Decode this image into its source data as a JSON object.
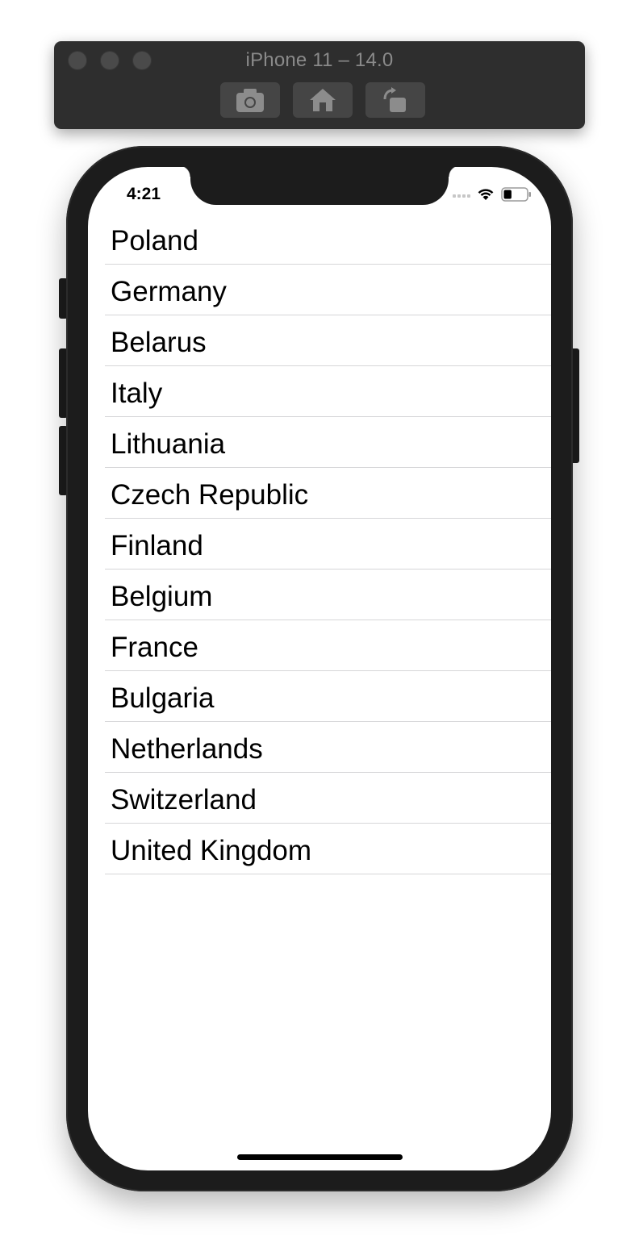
{
  "simulator": {
    "title": "iPhone 11 – 14.0",
    "toolbar_buttons": [
      {
        "icon": "camera-icon",
        "action": "screenshot"
      },
      {
        "icon": "home-icon",
        "action": "home"
      },
      {
        "icon": "rotate-icon",
        "action": "rotate"
      }
    ]
  },
  "status_bar": {
    "time": "4:21",
    "battery_level": 0.35
  },
  "countries": [
    "Poland",
    "Germany",
    "Belarus",
    "Italy",
    "Lithuania",
    "Czech Republic",
    "Finland",
    "Belgium",
    "France",
    "Bulgaria",
    "Netherlands",
    "Switzerland",
    "United Kingdom"
  ]
}
